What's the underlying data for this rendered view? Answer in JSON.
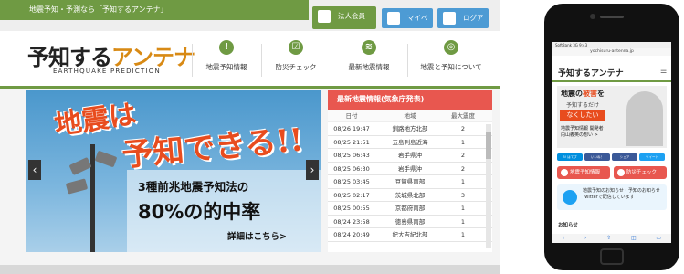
{
  "topbar": {
    "tagline": "地震予知・予測なら「予知するアンテナ」",
    "corp_label": "法人会員",
    "mypage_label": "マイページ",
    "logout_label": "ログアウト"
  },
  "header": {
    "logo_main": "予知する",
    "logo_accent": "アンテナ",
    "logo_sub": "EARTHQUAKE PREDICTION",
    "nav": [
      {
        "label": "地震予知情報",
        "icon": "!"
      },
      {
        "label": "防災チェック",
        "icon": "☑"
      },
      {
        "label": "最新地震情報",
        "icon": "≋"
      },
      {
        "label": "地震と予知について",
        "icon": "◎"
      }
    ]
  },
  "hero": {
    "line1": "地震は",
    "line2": "予知できる!!",
    "line3": "3種前兆地震予知法の",
    "line4": "80%の的中率",
    "detail": "詳細はこちら>",
    "prev": "‹",
    "next": "›"
  },
  "quake": {
    "title": "最新地震情報(気象庁発表)",
    "headers": [
      "日付",
      "地域",
      "最大震度"
    ],
    "rows": [
      [
        "08/26 19:47",
        "釧路地方北部",
        "2"
      ],
      [
        "08/25 21:51",
        "五島列島近海",
        "1"
      ],
      [
        "08/25 06:43",
        "岩手県沖",
        "2"
      ],
      [
        "08/25 06:30",
        "岩手県沖",
        "2"
      ],
      [
        "08/25 03:45",
        "豆賀県南部",
        "1"
      ],
      [
        "08/25 02:17",
        "茨城県北部",
        "3"
      ],
      [
        "08/25 00:55",
        "京都府南部",
        "1"
      ],
      [
        "08/24 23:58",
        "徳島県南部",
        "1"
      ],
      [
        "08/24 20:49",
        "紀大吉紀北部",
        "1"
      ]
    ]
  },
  "phone": {
    "status": "SoftBank 3G",
    "time": "9:43",
    "url": "yochisuru-antenna.jp",
    "logo": "予知するアンテナ",
    "menu": "☰",
    "banner_a": "地震の",
    "banner_red": "被害",
    "banner_b": "を",
    "banner_sub": "予知するだけ",
    "banner_box": "なくしたい",
    "banner_person": "地震予知情報 開発者 内山義英の想い >",
    "social": [
      "B! はてブ",
      "いいね！",
      "シェア",
      "ツイート"
    ],
    "btn_quake": "地震予知情報",
    "btn_check": "防災チェック",
    "twitter_text": "地震予知のお知らせ・予知のお知らせTwitterで配信しています",
    "news_label": "お知らせ",
    "tools": [
      "‹",
      "›",
      "⇧",
      "◫",
      "▭"
    ]
  }
}
